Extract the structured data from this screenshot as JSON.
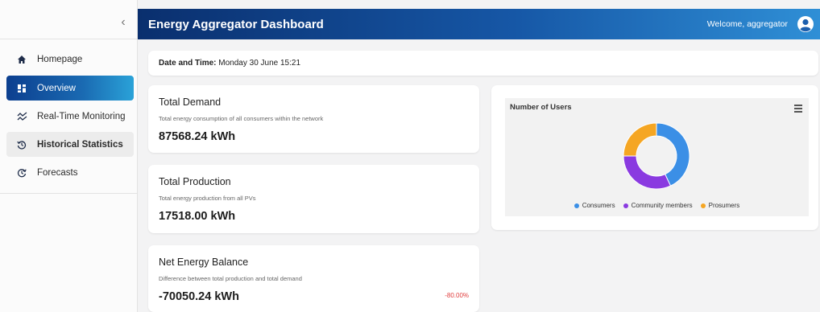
{
  "header": {
    "title": "Energy Aggregator Dashboard",
    "welcome": "Welcome, aggregator"
  },
  "sidebar": {
    "collapse_glyph": "‹",
    "items": [
      {
        "label": "Homepage",
        "icon": "home-icon"
      },
      {
        "label": "Overview",
        "icon": "dashboard-icon",
        "active": true
      },
      {
        "label": "Real-Time Monitoring",
        "icon": "realtime-icon"
      },
      {
        "label": "Historical Statistics",
        "icon": "history-icon"
      },
      {
        "label": "Forecasts",
        "icon": "forecast-icon"
      }
    ]
  },
  "datetime": {
    "label": "Date and Time:",
    "value": "Monday 30 June 15:21"
  },
  "stats": {
    "demand": {
      "title": "Total Demand",
      "desc": "Total energy consumption of all consumers within the network",
      "value": "87568.24 kWh"
    },
    "production": {
      "title": "Total Production",
      "desc": "Total energy production from all PVs",
      "value": "17518.00 kWh"
    },
    "balance": {
      "title": "Net Energy Balance",
      "desc": "Difference between total production and total demand",
      "value": "-70050.24 kWh",
      "percent": "-80.00%"
    }
  },
  "colors": {
    "consumers": "#3b8fe6",
    "community": "#8a3ae0",
    "prosumers": "#f5a623",
    "negative": "#e03c3c"
  },
  "chart_data": {
    "type": "pie",
    "title": "Number of Users",
    "categories": [
      "Consumers",
      "Community members",
      "Prosumers"
    ],
    "values": [
      43,
      32,
      25
    ]
  }
}
